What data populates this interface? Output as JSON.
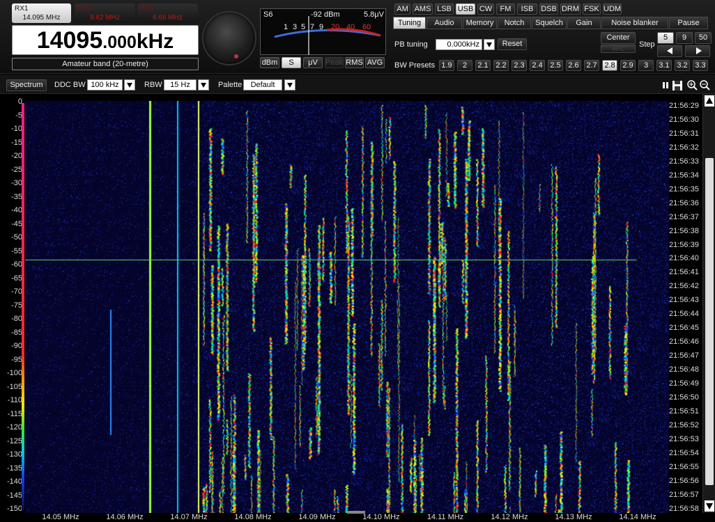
{
  "rx_tabs": [
    {
      "name": "RX1",
      "freq": "14.095 MHz"
    },
    {
      "name": "RX2",
      "freq": "9.62 MHz"
    },
    {
      "name": "RX3",
      "freq": "6.66 MHz"
    }
  ],
  "frequency": {
    "main": "14095",
    "sub": ".000",
    "unit": "kHz"
  },
  "band_label": "Amateur band (20-metre)",
  "meter": {
    "s_value": "S6",
    "dbm": "-92 dBm",
    "uv": "5.8μV",
    "scale_white": [
      "1",
      "3",
      "5",
      "7",
      "9"
    ],
    "scale_red": [
      "20",
      "40",
      "60"
    ],
    "buttons": {
      "dbm": "dBm",
      "s": "S",
      "uv": "μV",
      "peak": "Peak",
      "rms": "RMS",
      "avg": "AVG"
    }
  },
  "modes": [
    "AM",
    "AMS",
    "LSB",
    "USB",
    "CW",
    "FM",
    "ISB",
    "DSB",
    "DRM",
    "FSK",
    "UDM"
  ],
  "selected_mode": "USB",
  "control_tabs": [
    "Tuning",
    "Audio",
    "Memory",
    "Notch",
    "Squelch",
    "Gain",
    "Noise blanker",
    "Pause"
  ],
  "tuning": {
    "pb_label": "PB tuning",
    "pb_value": "0.000kHz",
    "reset": "Reset",
    "center": "Center",
    "center_sub": "AFC",
    "step_label": "Step",
    "step_values": [
      "5",
      "9",
      "50"
    ]
  },
  "bw_presets": {
    "label": "BW Presets",
    "values": [
      "1.9",
      "2",
      "2.1",
      "2.2",
      "2.3",
      "2.4",
      "2.5",
      "2.6",
      "2.7",
      "2.8",
      "2.9",
      "3",
      "3.1",
      "3.2",
      "3.3"
    ],
    "selected": "2.8"
  },
  "toolbar": {
    "spectrum": "Spectrum",
    "ddc_label": "DDC BW",
    "ddc_value": "100 kHz",
    "rbw_label": "RBW",
    "rbw_value": "15 Hz",
    "palette_label": "Palette",
    "palette_value": "Default"
  },
  "y_ticks": [
    "0",
    "-5",
    "-10",
    "-15",
    "-20",
    "-25",
    "-30",
    "-35",
    "-40",
    "-45",
    "-50",
    "-55",
    "-60",
    "-65",
    "-70",
    "-75",
    "-80",
    "-85",
    "-90",
    "-95",
    "-100",
    "-105",
    "-110",
    "-115",
    "-120",
    "-125",
    "-130",
    "-135",
    "-140",
    "-145",
    "-150"
  ],
  "time_ticks": [
    "21:56:29",
    "21:56:30",
    "21:56:31",
    "21:56:32",
    "21:56:33",
    "21:56:34",
    "21:56:35",
    "21:56:36",
    "21:56:37",
    "21:56:38",
    "21:56:39",
    "21:56:40",
    "21:56:41",
    "21:56:42",
    "21:56:43",
    "21:56:44",
    "21:56:45",
    "21:56:46",
    "21:56:47",
    "21:56:48",
    "21:56:49",
    "21:56:50",
    "21:56:51",
    "21:56:52",
    "21:56:53",
    "21:56:54",
    "21:56:55",
    "21:56:56",
    "21:56:57",
    "21:56:58"
  ],
  "freq_ticks": [
    "14.05 MHz",
    "14.06 MHz",
    "14.07 MHz",
    "14.08 MHz",
    "14.09 MHz",
    "14.10 MHz",
    "14.11 MHz",
    "14.12 MHz",
    "14.13 MHz",
    "14.14 MHz"
  ],
  "colors": {
    "accent_red": "#b81a1a",
    "panel_bg": "#1a1a1a",
    "waterfall_bg": "#05052a"
  }
}
